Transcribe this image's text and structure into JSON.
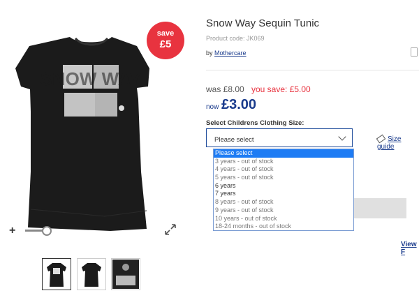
{
  "product": {
    "title": "Snow Way Sequin Tunic",
    "product_code": "Product code: JK069",
    "by_prefix": "by",
    "brand": "Mothercare",
    "badge": {
      "line1": "save",
      "line2": "£5",
      "color": "#e8333f"
    },
    "shirt_print": "SNOW WAY"
  },
  "price": {
    "was": "was £8.00",
    "you_save": "you save: £5.00",
    "now_label": "now",
    "now_value": "£3.00"
  },
  "size": {
    "label": "Select Childrens Clothing Size:",
    "selected": "Please select",
    "size_guide": "Size guide",
    "options": [
      {
        "label": "Please select",
        "highlighted": true
      },
      {
        "label": "3 years - out of stock"
      },
      {
        "label": "4 years - out of stock"
      },
      {
        "label": "5 years - out of stock"
      },
      {
        "label": "6 years"
      },
      {
        "label": "7 years"
      },
      {
        "label": "8 years - out of stock"
      },
      {
        "label": "9 years - out of stock"
      },
      {
        "label": "10 years - out of stock"
      },
      {
        "label": "18-24 months - out of stock"
      }
    ]
  },
  "view_link": "View F",
  "icons": [
    "plus-icon",
    "expand-icon",
    "tag-icon",
    "chevron-down-icon",
    "favourite-icon"
  ]
}
